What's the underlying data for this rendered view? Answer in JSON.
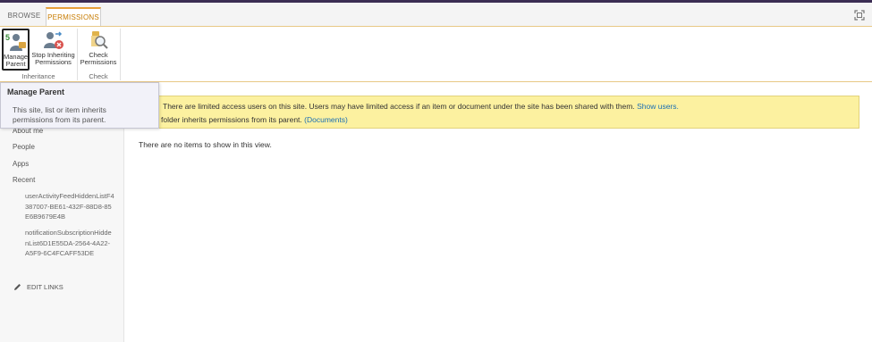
{
  "tabs": [
    {
      "label": "BROWSE",
      "selected": false
    },
    {
      "label": "PERMISSIONS",
      "selected": true
    }
  ],
  "ribbon": {
    "manage_parent": {
      "line1": "Manage",
      "line2": "Parent"
    },
    "stop_inheriting": {
      "line1": "Stop Inheriting",
      "line2": "Permissions"
    },
    "check_permissions": {
      "line1": "Check",
      "line2": "Permissions"
    },
    "groups": {
      "inheritance": "Inheritance",
      "check": "Check"
    }
  },
  "tooltip": {
    "title": "Manage Parent",
    "body": "This site, list or item inherits permissions from its parent."
  },
  "notice": {
    "line1": "There are limited access users on this site. Users may have limited access if an item or document under the site has been shared with them.",
    "line1_link": "Show users.",
    "line2": "folder inherits permissions from its parent.",
    "line2_link": "(Documents)"
  },
  "nav": {
    "items": [
      "About me",
      "People",
      "Apps",
      "Recent"
    ],
    "recent": [
      "userActivityFeedHiddenListF4387007-BE61-432F-88D8-85E6B9679E4B",
      "notificationSubscriptionHiddenList6D1E55DA-2564-4A22-A5F9-6C4FCAFF53DE"
    ],
    "edit_links": "EDIT LINKS"
  },
  "main": {
    "empty_message": "There are no items to show in this view."
  },
  "colors": {
    "accent": "#e8a13a",
    "topbar": "#3b2d53",
    "notice_bg": "#fcf1a0",
    "link": "#1a6fb4"
  },
  "icons": {
    "focus": "focus-on-content-icon",
    "manage_parent": "manage-parent-icon",
    "stop_inheriting": "stop-inheriting-icon",
    "check": "check-permissions-icon",
    "edit": "pencil-icon"
  }
}
